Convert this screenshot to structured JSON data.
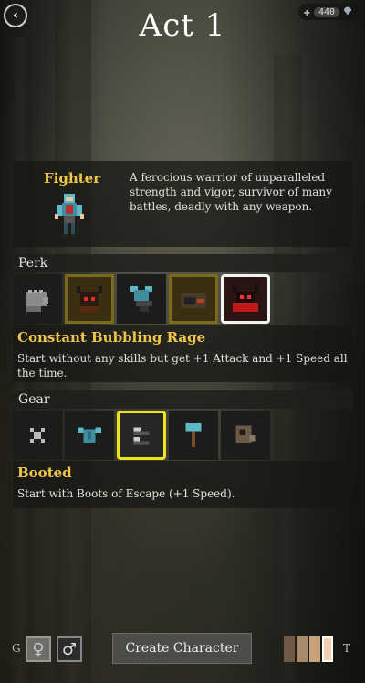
{
  "header": {
    "title": "Act 1",
    "back_icon": "‹",
    "currency_amount": "440"
  },
  "hero": {
    "name": "Fighter",
    "description": "A ferocious warrior of unparalleled strength and vigor, survivor of many battles, deadly with any weapon."
  },
  "perk": {
    "heading": "Perk",
    "items": [
      {
        "icon": "fist-icon",
        "state": "plain"
      },
      {
        "icon": "horned-demon-icon",
        "state": "framed"
      },
      {
        "icon": "armor-anvil-icon",
        "state": "plain"
      },
      {
        "icon": "boot-chest-icon",
        "state": "framed"
      },
      {
        "icon": "red-demon-icon",
        "state": "selected"
      }
    ],
    "selected_name": "Constant Bubbling Rage",
    "selected_description": "Start without any skills but get +1 Attack and +1 Speed all the time."
  },
  "gear": {
    "heading": "Gear",
    "items": [
      {
        "icon": "x-mark-icon",
        "state": "plain"
      },
      {
        "icon": "armor-icon",
        "state": "plain"
      },
      {
        "icon": "boots-icon",
        "state": "selected"
      },
      {
        "icon": "hammer-icon",
        "state": "plain"
      },
      {
        "icon": "scroll-icon",
        "state": "plain"
      }
    ],
    "selected_name": "Booted",
    "selected_description": "Start with Boots of Escape (+1 Speed)."
  },
  "footer": {
    "gender_label": "G",
    "female_symbol": "♀",
    "male_symbol": "♂",
    "create_label": "Create Character",
    "tone_label": "T",
    "skin_tones": [
      "#6f5a48",
      "#a8896a",
      "#c9a27a",
      "#f2cfb0"
    ],
    "selected_tone_index": 3
  },
  "colors": {
    "accent_gold": "#f0c64a",
    "selected_yellow": "#f2e21a",
    "selected_white": "#f2f2f2"
  }
}
